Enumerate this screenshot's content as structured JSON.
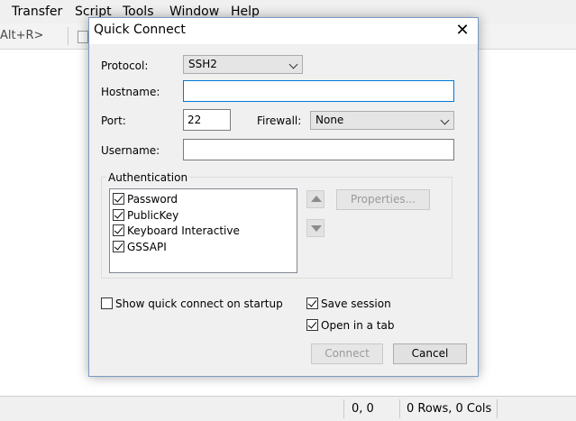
{
  "menubar": {
    "items": [
      "Transfer",
      "Script",
      "Tools",
      "Window",
      "Help"
    ]
  },
  "toolbar": {
    "shortcut_text": "Alt+R>"
  },
  "statusbar": {
    "cursor": "0, 0",
    "size": "0 Rows, 0 Cols"
  },
  "dialog": {
    "title": "Quick Connect",
    "close_glyph": "✕",
    "protocol": {
      "label": "Protocol:",
      "value": "SSH2"
    },
    "hostname": {
      "label": "Hostname:",
      "value": ""
    },
    "port": {
      "label": "Port:",
      "value": "22"
    },
    "firewall": {
      "label": "Firewall:",
      "value": "None"
    },
    "username": {
      "label": "Username:",
      "value": ""
    },
    "authentication": {
      "group_label": "Authentication",
      "methods": [
        {
          "label": "Password",
          "checked": true
        },
        {
          "label": "PublicKey",
          "checked": true
        },
        {
          "label": "Keyboard Interactive",
          "checked": true
        },
        {
          "label": "GSSAPI",
          "checked": true
        }
      ],
      "properties_label": "Properties..."
    },
    "show_on_startup": {
      "label": "Show quick connect on startup",
      "checked": false
    },
    "save_session": {
      "label": "Save session",
      "checked": true
    },
    "open_in_tab": {
      "label": "Open in a tab",
      "checked": true
    },
    "connect_label": "Connect",
    "cancel_label": "Cancel"
  }
}
